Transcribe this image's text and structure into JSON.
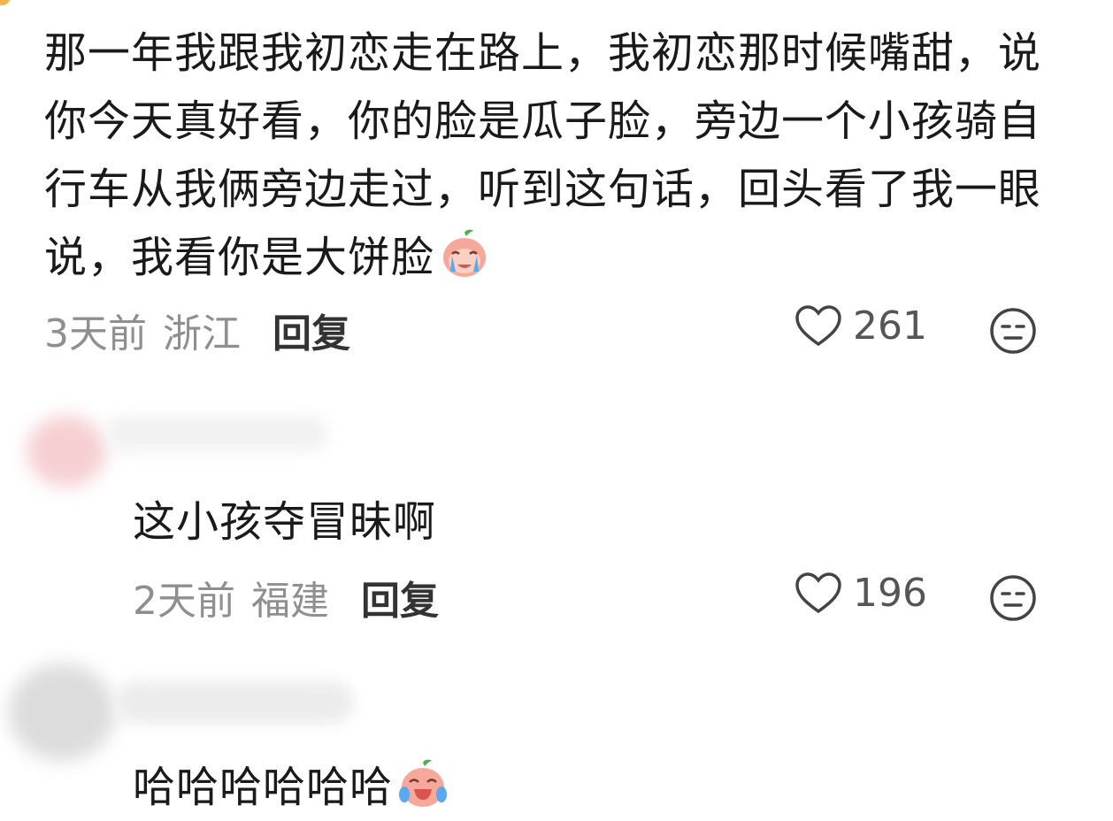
{
  "comment1": {
    "text": "那一年我跟我初恋走在路上，我初恋那时候嘴甜，说你今天真好看，你的脸是瓜子脸，旁边一个小孩骑自行车从我俩旁边走过，听到这句话，回头看了我一眼说，我看你是大饼脸",
    "emoji": "crying-peach-emoji",
    "time": "3天前",
    "location": "浙江",
    "reply_label": "回复",
    "likes": "261"
  },
  "reply1": {
    "text": "这小孩夺冒昧啊",
    "time": "2天前",
    "location": "福建",
    "reply_label": "回复",
    "likes": "196"
  },
  "reply2": {
    "text": "哈哈哈哈哈哈",
    "emoji": "laughing-peach-emoji"
  },
  "colors": {
    "text": "#1a1a1a",
    "meta": "#8f8f8f",
    "emoji_peach": "#f6a99a",
    "emoji_tear": "#5aa8f0",
    "emoji_leaf": "#4caf50"
  }
}
